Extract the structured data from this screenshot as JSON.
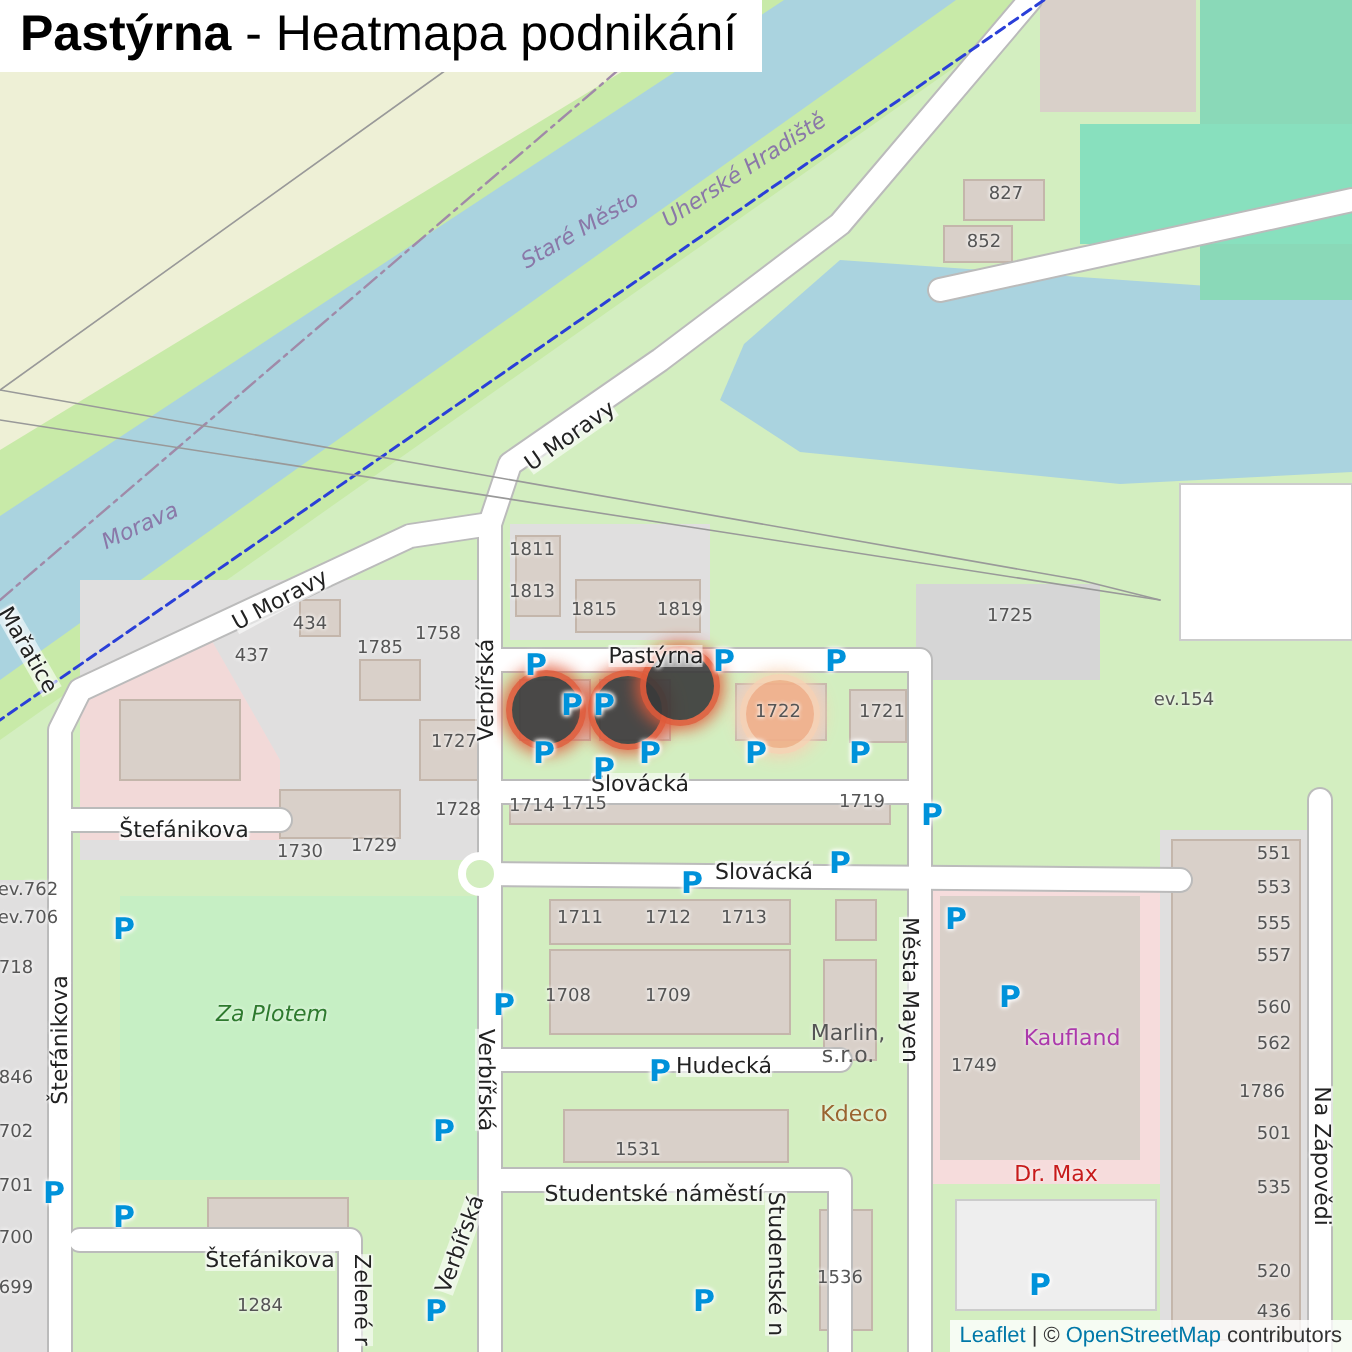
{
  "title": "**Pastýrna** - Heatmapa podnikání",
  "map": {
    "water_labels": [
      "Morava",
      "Staré Město",
      "Uherské Hradiště"
    ],
    "streets": [
      "U Moravy",
      "U Moravy",
      "Pastýrna",
      "Slovácká",
      "Slovácká",
      "Štefánikova",
      "Štefánikova",
      "Štefánikova",
      "Verbířská",
      "Verbířská",
      "Verbířská",
      "Hudecká",
      "Studentské náměstí",
      "Města Mayen",
      "Studentské n",
      "Zelené r",
      "Na Zápovědi",
      "Mařatice"
    ],
    "house_numbers": [
      "827",
      "852",
      "1811",
      "1813",
      "1815",
      "1819",
      "434",
      "437",
      "1785",
      "1758",
      "1727",
      "1728",
      "1730",
      "1729",
      "1725",
      "1722",
      "1721",
      "1714",
      "1715",
      "1719",
      "1711",
      "1712",
      "1713",
      "1708",
      "1709",
      "1749",
      "1531",
      "1536",
      "551",
      "553",
      "555",
      "557",
      "560",
      "562",
      "1786",
      "501",
      "535",
      "520",
      "436",
      "ev.154",
      "ev.762",
      "ev.706",
      "718",
      "846",
      "702",
      "701",
      "700",
      "699",
      "1284"
    ],
    "places": [
      {
        "kind": "park",
        "label": "Za Plotem"
      },
      {
        "kind": "business",
        "label": "Marlin, s.r.o."
      },
      {
        "kind": "shop",
        "label": "Kdeco"
      },
      {
        "kind": "supermarket",
        "label": "Kaufland"
      },
      {
        "kind": "pharmacy",
        "label": "Dr. Max"
      }
    ],
    "parking": [
      "P",
      "P",
      "P",
      "P",
      "P",
      "P",
      "P",
      "P",
      "P",
      "P",
      "P",
      "P",
      "P",
      "P",
      "P",
      "P",
      "P",
      "P",
      "P",
      "P",
      "P",
      "P",
      "P",
      "P"
    ],
    "heat_spots": [
      {
        "hot": true
      },
      {
        "hot": true
      },
      {
        "hot": true
      },
      {
        "hot": false
      }
    ]
  },
  "attribution": {
    "leaflet": "Leaflet",
    "separator": "| ©",
    "osm": "OpenStreetMap",
    "suffix": "contributors"
  }
}
